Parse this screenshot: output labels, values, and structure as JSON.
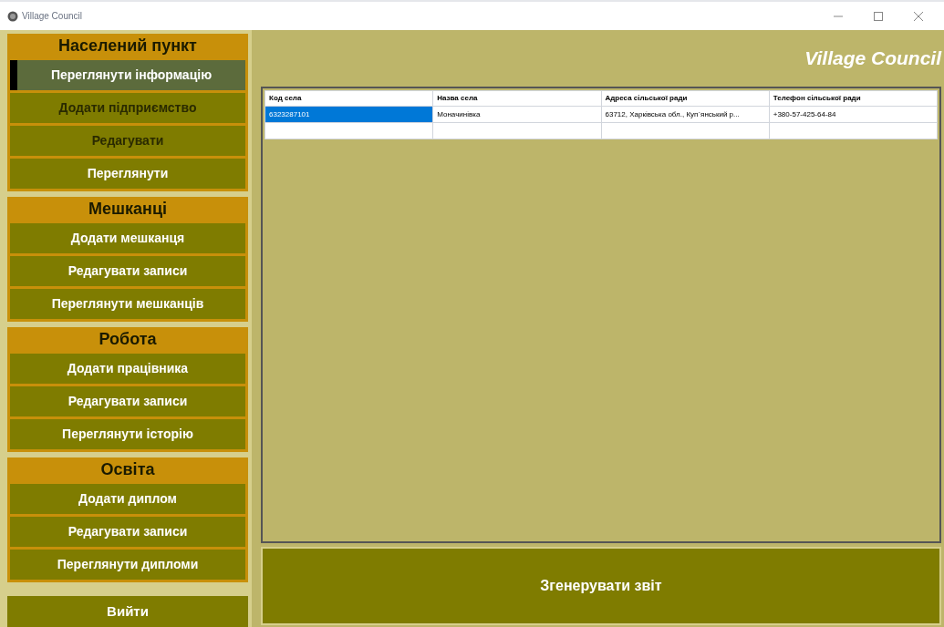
{
  "window": {
    "title": "Village Council"
  },
  "sidebar": {
    "sections": [
      {
        "title": "Населений пункт",
        "items": [
          {
            "label": "Переглянути інформацію",
            "selected": true,
            "disabled": false
          },
          {
            "label": "Додати підприємство",
            "selected": false,
            "disabled": true
          },
          {
            "label": "Редагувати",
            "selected": false,
            "disabled": true
          },
          {
            "label": "Переглянути",
            "selected": false,
            "disabled": false
          }
        ]
      },
      {
        "title": "Мешканці",
        "items": [
          {
            "label": "Додати мешканця",
            "selected": false,
            "disabled": false
          },
          {
            "label": "Редагувати записи",
            "selected": false,
            "disabled": false
          },
          {
            "label": "Переглянути мешканців",
            "selected": false,
            "disabled": false
          }
        ]
      },
      {
        "title": "Робота",
        "items": [
          {
            "label": "Додати працівника",
            "selected": false,
            "disabled": false
          },
          {
            "label": "Редагувати записи",
            "selected": false,
            "disabled": false
          },
          {
            "label": "Переглянути історію",
            "selected": false,
            "disabled": false
          }
        ]
      },
      {
        "title": "Освіта",
        "items": [
          {
            "label": "Додати диплом",
            "selected": false,
            "disabled": false
          },
          {
            "label": "Редагувати записи",
            "selected": false,
            "disabled": false
          },
          {
            "label": "Переглянути дипломи",
            "selected": false,
            "disabled": false
          }
        ]
      }
    ],
    "exit": "Вийти"
  },
  "header": {
    "title": "Village Council"
  },
  "table": {
    "columns": [
      "Код села",
      "Назва села",
      "Адреса сільської ради",
      "Телефон сільської ради"
    ],
    "rows": [
      {
        "selected": true,
        "cells": [
          "6323287101",
          "Моначинівка",
          "63712, Харківська обл., Куп`янський р...",
          "+380-57-425-64-84"
        ]
      }
    ]
  },
  "report_button": "Згенерувати звіт"
}
